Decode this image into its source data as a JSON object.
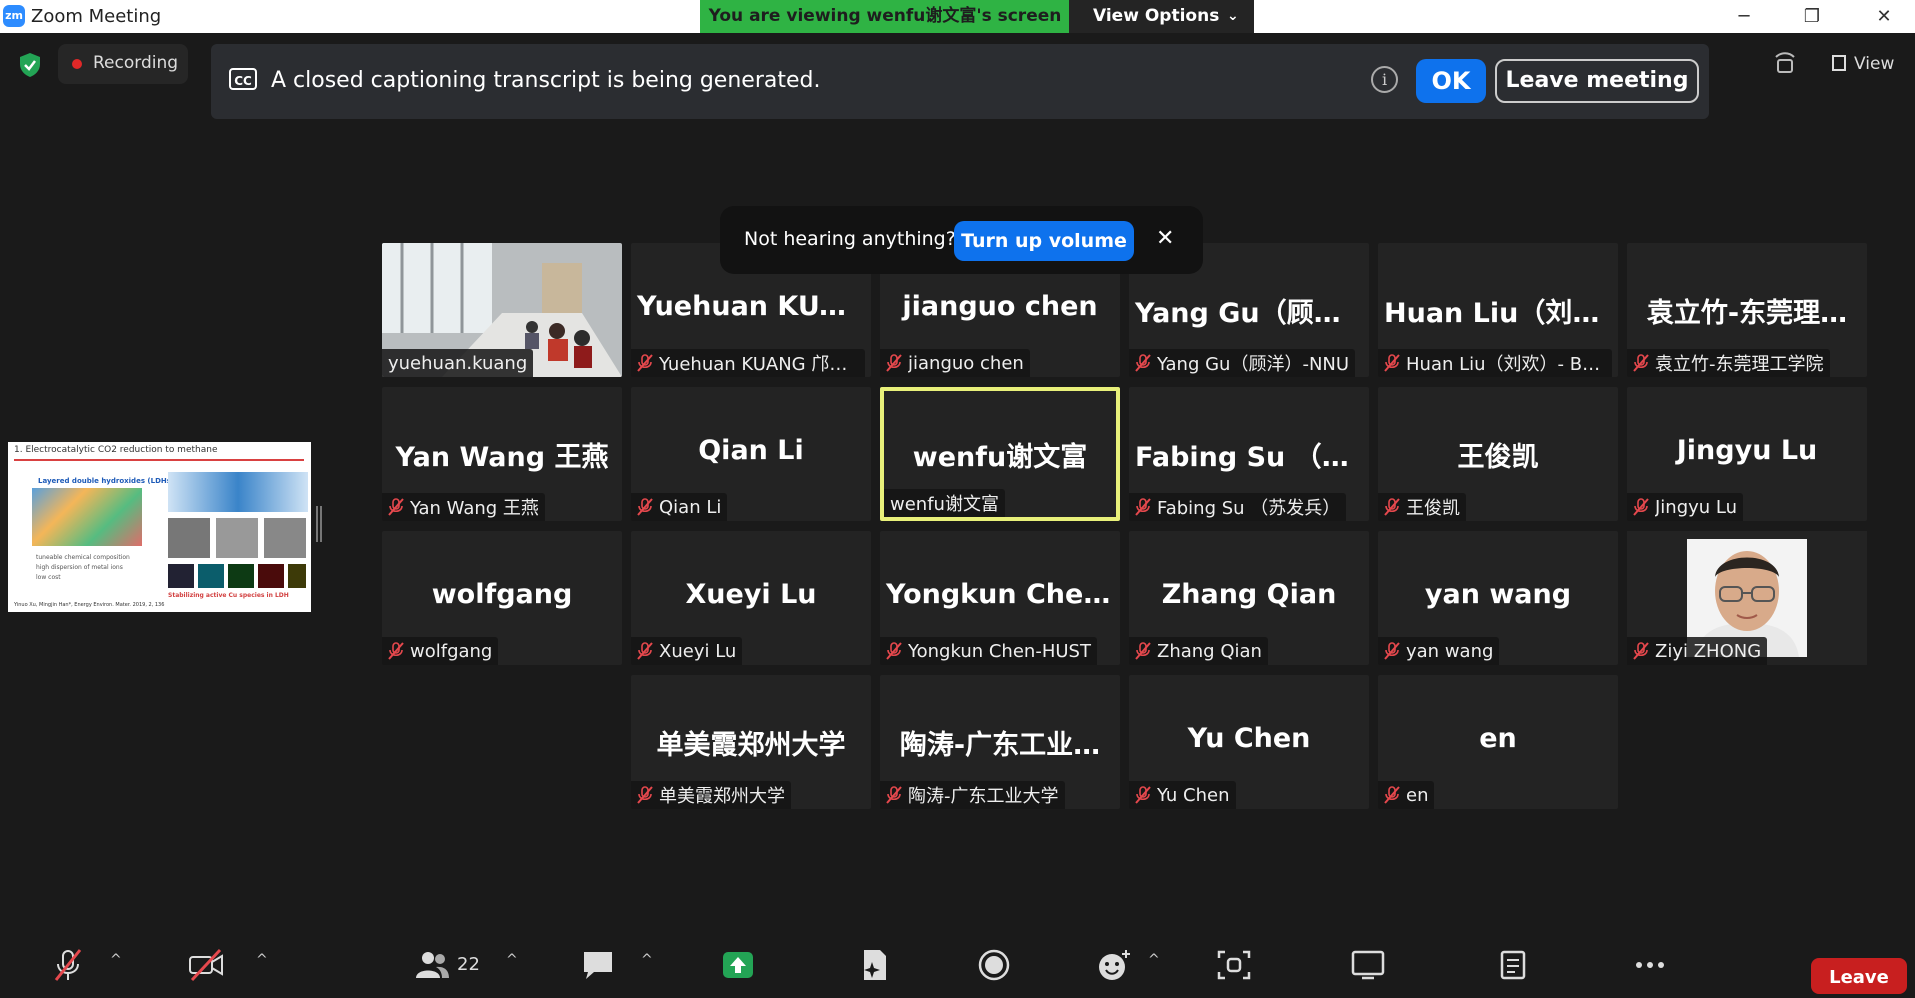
{
  "window": {
    "title": "Zoom Meeting",
    "logo_text": "zm",
    "controls": {
      "minimize": "─",
      "restore": "❐",
      "close": "✕"
    }
  },
  "share_banner": {
    "viewing_text": "You are viewing wenfu谢文富's screen",
    "view_options_label": "View Options"
  },
  "top_bar": {
    "recording_label": "Recording",
    "view_label": "View"
  },
  "cc_banner": {
    "icon_text": "CC",
    "message": "A closed captioning transcript is being generated.",
    "info_glyph": "i",
    "ok_label": "OK",
    "leave_meeting_label": "Leave meeting"
  },
  "volume_toast": {
    "message": "Not hearing anything?",
    "button_label": "Turn up volume",
    "close_glyph": "✕"
  },
  "shared_slide": {
    "title": "1. Electrocatalytic CO2 reduction to methane",
    "subtitle": "Layered double hydroxides (LDHs)",
    "bullets": [
      "tuneable chemical composition",
      "high dispersion of metal ions",
      "low cost"
    ],
    "caption": "Stabilizing active Cu species in LDH",
    "citation": "Yinuo Xu, Mingjin Han*, Energy Environ. Mater. 2019, 2, 136"
  },
  "participants": [
    {
      "name": "",
      "label": "yuehuan.kuang",
      "muted": false,
      "video": "room"
    },
    {
      "name": "Yuehuan  KUANG…",
      "label": "Yuehuan KUANG 邝悦…",
      "muted": true
    },
    {
      "name": "jianguo chen",
      "label": "jianguo chen",
      "muted": true
    },
    {
      "name": "Yang  Gu（顾洋…",
      "label": "Yang Gu（顾洋）-NNU",
      "muted": true
    },
    {
      "name": "Huan  Liu（刘欢…",
      "label": "Huan Liu（刘欢）- BU…",
      "muted": true
    },
    {
      "name": "袁立竹-东莞理…",
      "label": "袁立竹-东莞理工学院",
      "muted": true
    },
    {
      "name": "Yan  Wang 王燕",
      "label": "Yan Wang 王燕",
      "muted": true
    },
    {
      "name": "Qian Li",
      "label": "Qian Li",
      "muted": true
    },
    {
      "name": "wenfu谢文富",
      "label": "wenfu谢文富",
      "muted": false,
      "active": true
    },
    {
      "name": "Fabing  Su （苏…",
      "label": "Fabing Su （苏发兵）",
      "muted": true
    },
    {
      "name": "王俊凯",
      "label": "王俊凯",
      "muted": true
    },
    {
      "name": "Jingyu Lu",
      "label": "Jingyu Lu",
      "muted": true
    },
    {
      "name": "wolfgang",
      "label": "wolfgang",
      "muted": true
    },
    {
      "name": "Xueyi Lu",
      "label": "Xueyi Lu",
      "muted": true
    },
    {
      "name": "Yongkun  Chen-…",
      "label": "Yongkun Chen-HUST",
      "muted": true
    },
    {
      "name": "Zhang Qian",
      "label": "Zhang Qian",
      "muted": true
    },
    {
      "name": "yan wang",
      "label": "yan wang",
      "muted": true
    },
    {
      "name": "",
      "label": "Ziyi ZHONG",
      "muted": true,
      "video": "face"
    },
    {
      "name": "单美霞郑州大学",
      "label": "单美霞郑州大学",
      "muted": true
    },
    {
      "name": "陶涛-广东工业…",
      "label": "陶涛-广东工业大学",
      "muted": true
    },
    {
      "name": "Yu Chen",
      "label": "Yu Chen",
      "muted": true
    },
    {
      "name": "en",
      "label": "en",
      "muted": true
    }
  ],
  "toolbar": {
    "participant_count": "22",
    "caret_glyph": "^",
    "leave_label": "Leave"
  },
  "colors": {
    "zoom_blue": "#0e72ed",
    "share_green": "#2fb344",
    "active_speaker": "#e8f07a",
    "mute_red": "#e5484d",
    "leave_red": "#c81f1f"
  }
}
